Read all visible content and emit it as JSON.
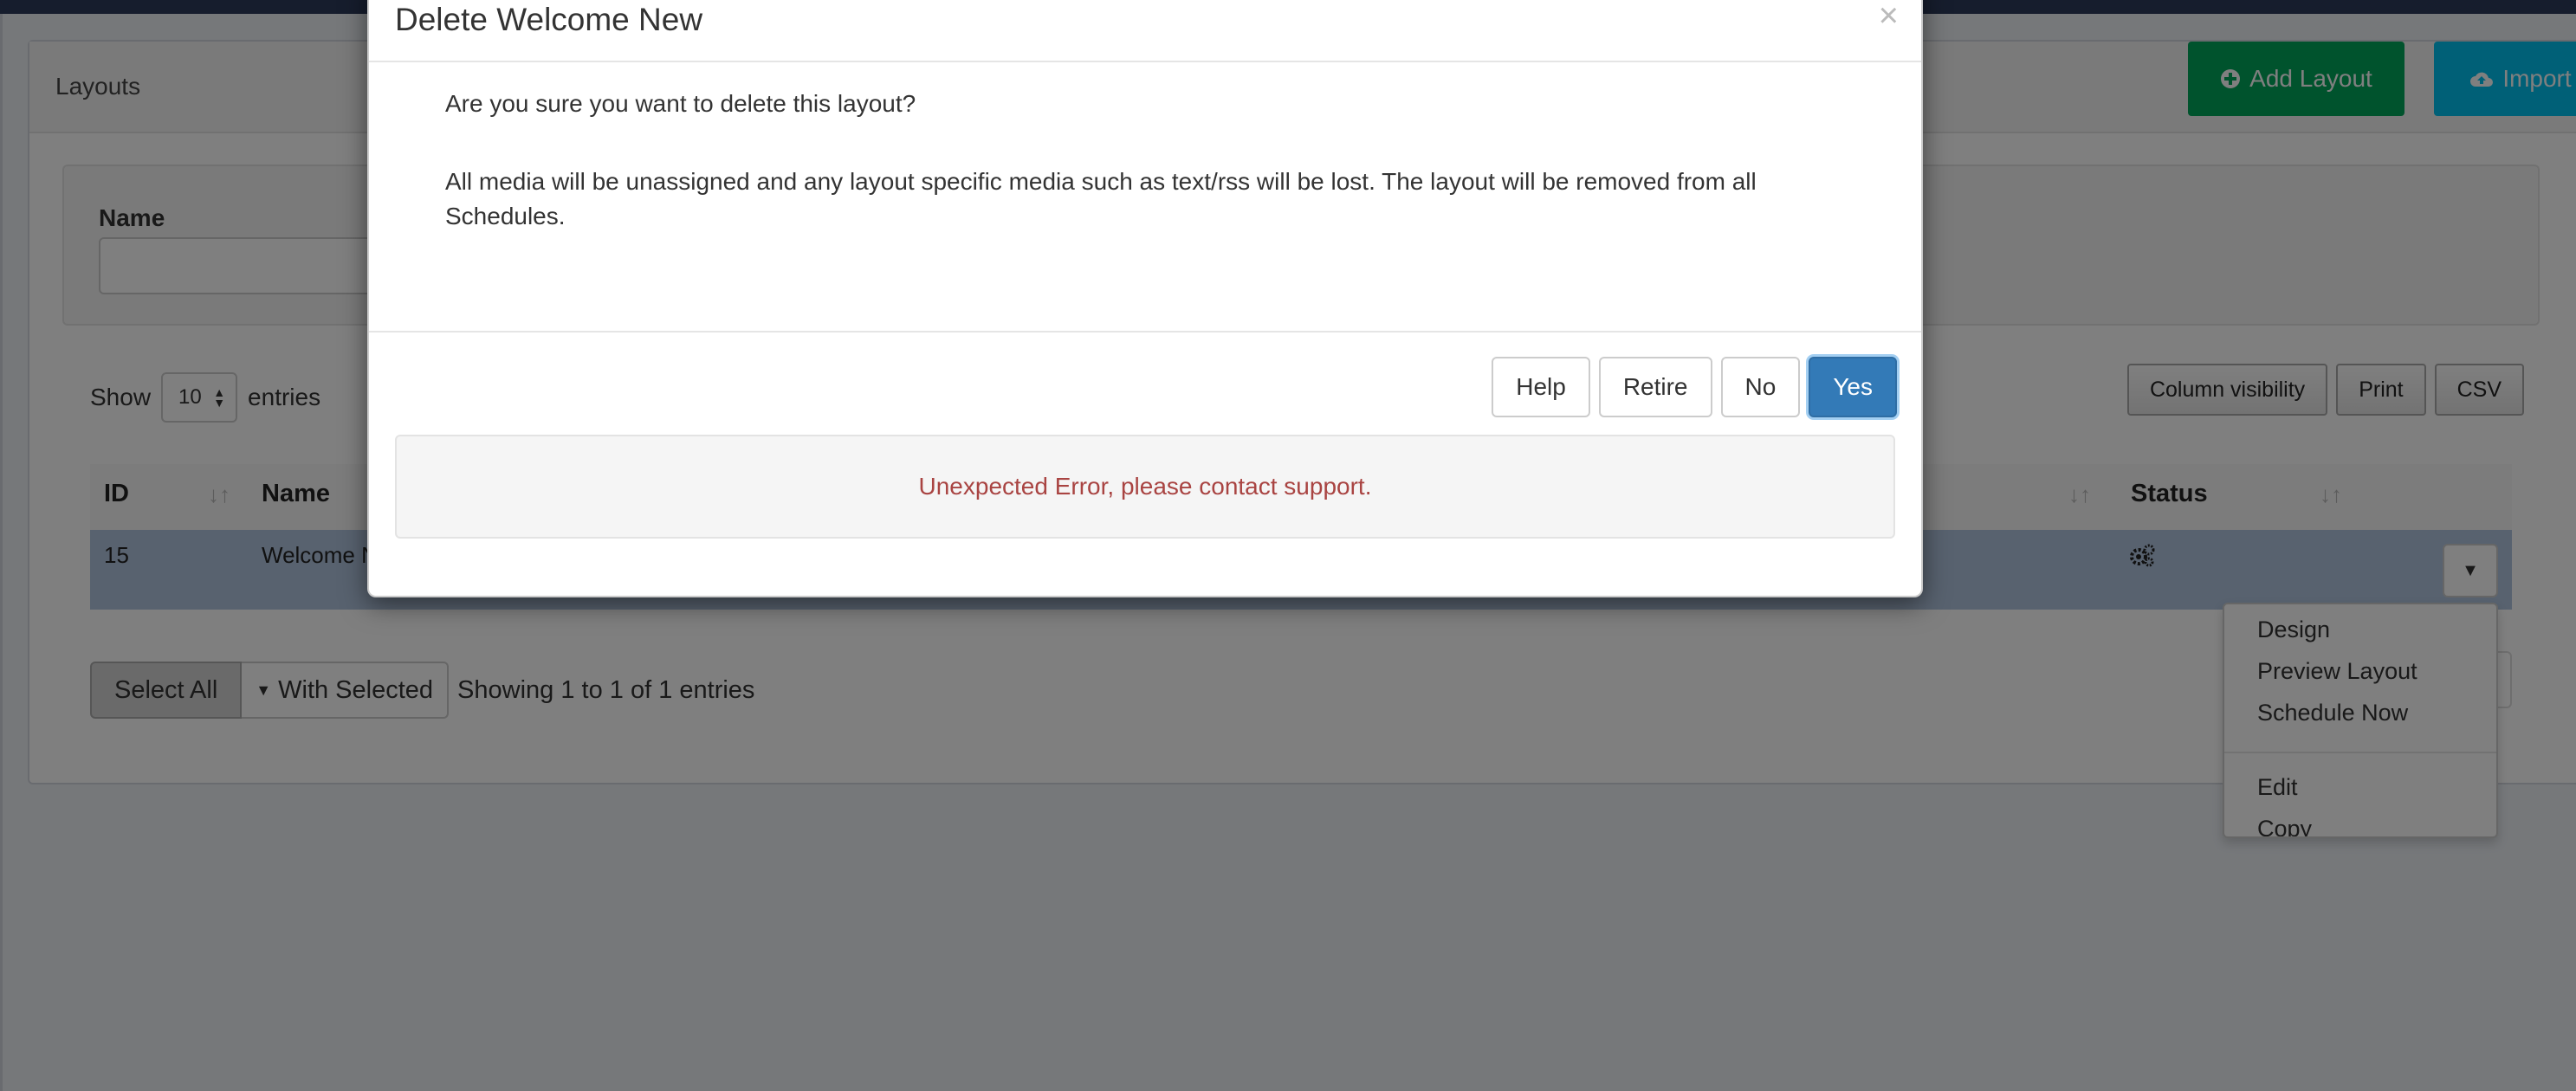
{
  "page": {
    "panel_title": "Layouts",
    "header_buttons": {
      "add_layout": "Add Layout",
      "add_layout_icon": "plus-circle-icon",
      "import": "Import",
      "import_icon": "cloud-upload-icon"
    },
    "filter": {
      "name_label": "Name",
      "name_value": ""
    },
    "length": {
      "show_label": "Show",
      "value": "10",
      "entries_label": "entries"
    },
    "export_buttons": [
      "Column visibility",
      "Print",
      "CSV"
    ],
    "table": {
      "columns": [
        "ID",
        "Name",
        "Status"
      ],
      "rows": [
        {
          "id": "15",
          "name": "Welcome N",
          "status_icon": "gears-icon"
        }
      ]
    },
    "footer": {
      "select_all": "Select All",
      "with_selected": "With Selected",
      "showing": "Showing 1 to 1 of 1 entries"
    },
    "row_menu": [
      "Design",
      "Preview Layout",
      "Schedule Now",
      "Edit",
      "Copy"
    ]
  },
  "modal": {
    "title": "Delete Welcome New",
    "close": "×",
    "question": "Are you sure you want to delete this layout?",
    "warning": "All media will be unassigned and any layout specific media such as text/rss will be lost. The layout will be removed from all Schedules.",
    "buttons": {
      "help": "Help",
      "retire": "Retire",
      "no": "No",
      "yes": "Yes"
    },
    "error": "Unexpected Error, please contact support."
  },
  "colors": {
    "add_layout": "#00a65a",
    "import": "#00c0ef",
    "primary": "#337ab7",
    "error_text": "#a94442",
    "selected_row": "#b0c4de",
    "top_strip": "#2c3b5a"
  }
}
